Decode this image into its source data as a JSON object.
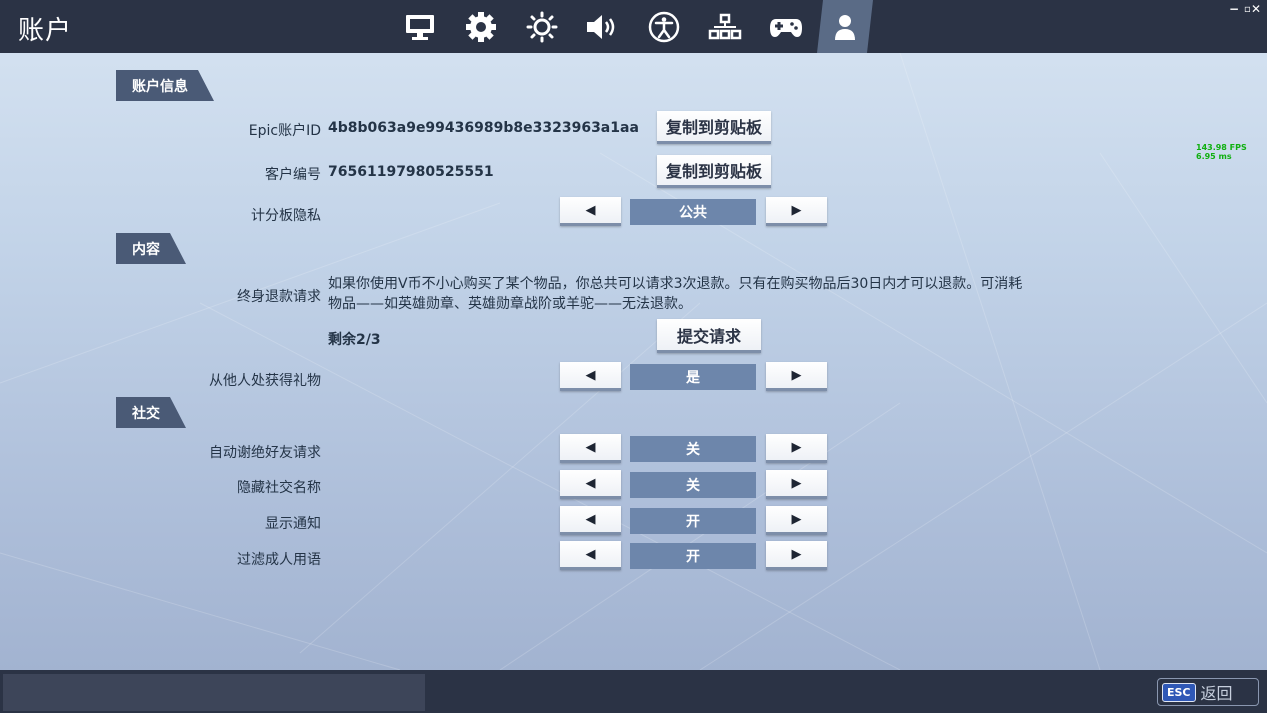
{
  "app_title": "账户",
  "nav_tabs": [
    {
      "icon": "monitor-icon"
    },
    {
      "icon": "gear-icon"
    },
    {
      "icon": "brightness-icon"
    },
    {
      "icon": "speaker-icon"
    },
    {
      "icon": "accessibility-icon"
    },
    {
      "icon": "network-icon"
    },
    {
      "icon": "gamepad-icon"
    },
    {
      "icon": "user-icon",
      "active": true
    }
  ],
  "window_controls": {
    "minimize": "−",
    "restore": "▫",
    "close": "✕"
  },
  "sections": {
    "account_info": "账户信息",
    "content": "内容",
    "social": "社交"
  },
  "account": {
    "epic_id_label": "Epic账户ID",
    "epic_id_value": "4b8b063a9e99436989b8e3323963a1aa",
    "client_no_label": "客户编号",
    "client_no_value": "76561197980525551",
    "copy_button": "复制到剪贴板",
    "scoreboard_label": "计分板隐私",
    "scoreboard_value": "公共"
  },
  "content": {
    "refund_label": "终身退款请求",
    "refund_text": "如果你使用V币不小心购买了某个物品，你总共可以请求3次退款。只有在购买物品后30日内才可以退款。可消耗物品——如英雄勋章、英雄勋章战阶或羊驼——无法退款。",
    "remaining": "剩余2/3",
    "submit_button": "提交请求",
    "gifts_label": "从他人处获得礼物",
    "gifts_value": "是"
  },
  "social": {
    "items": [
      {
        "label": "自动谢绝好友请求",
        "value": "关"
      },
      {
        "label": "隐藏社交名称",
        "value": "关"
      },
      {
        "label": "显示通知",
        "value": "开"
      },
      {
        "label": "过滤成人用语",
        "value": "开"
      }
    ]
  },
  "arrows": {
    "left": "◀",
    "right": "▶"
  },
  "fps": {
    "line1": "143.98 FPS",
    "line2": "6.95 ms"
  },
  "footer": {
    "esc_key": "ESC",
    "back_label": "返回"
  },
  "colors": {
    "topbar": "#2b3345",
    "section_header": "#4a5a76",
    "option_value": "#6d86ab",
    "fps_text": "#10b010"
  }
}
